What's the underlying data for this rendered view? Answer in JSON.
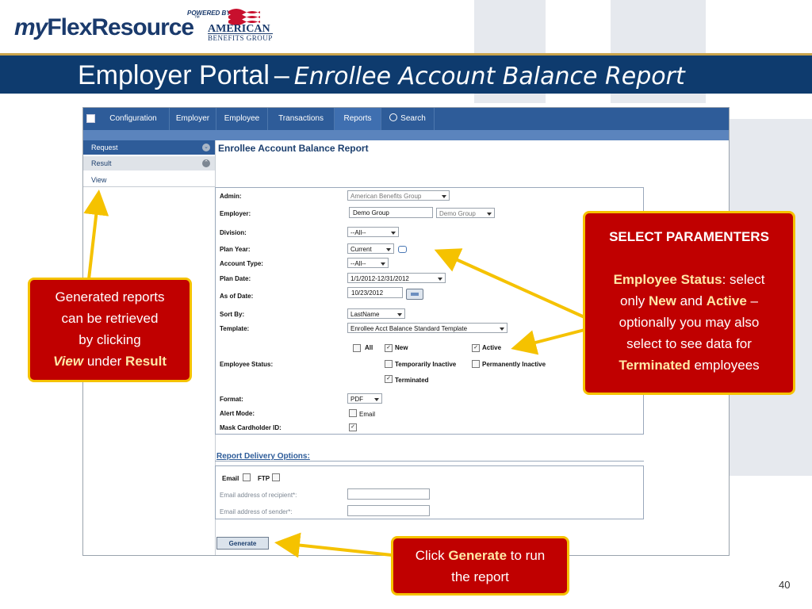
{
  "header": {
    "logo": {
      "my": "my",
      "flex": "FlexResource",
      "tm": "™"
    },
    "powered_by": "POWERED BY",
    "american_benefits": {
      "line1": "AMERICAN",
      "line2": "BENEFITS GROUP"
    }
  },
  "title": {
    "main": "Employer Portal",
    "dash": "–",
    "sub": "Enrollee Account Balance Report"
  },
  "app": {
    "nav_tabs": [
      "Configuration",
      "Employer",
      "Employee",
      "Transactions",
      "Reports",
      "Search"
    ],
    "active_tab": "Reports",
    "sidebar": {
      "request": "Request",
      "result": "Result",
      "view": "View"
    },
    "page_title": "Enrollee Account Balance Report",
    "form": {
      "admin_label": "Admin:",
      "admin_value": "American Benefits Group",
      "employer_label": "Employer:",
      "employer_input": "Demo Group",
      "employer_select": "Demo Group",
      "division_label": "Division:",
      "division_value": "--All--",
      "plan_year_label": "Plan Year:",
      "plan_year_value": "Current",
      "account_type_label": "Account Type:",
      "account_type_value": "--All--",
      "plan_date_label": "Plan Date:",
      "plan_date_value": "1/1/2012-12/31/2012",
      "as_of_date_label": "As of Date:",
      "as_of_date_value": "10/23/2012",
      "sort_by_label": "Sort By:",
      "sort_by_value": "LastName",
      "template_label": "Template:",
      "template_value": "Enrollee Acct Balance Standard Template",
      "employee_status_label": "Employee Status:",
      "status_all": "All",
      "status_new": "New",
      "status_active": "Active",
      "status_temp_inactive": "Temporarily Inactive",
      "status_perm_inactive": "Permanently Inactive",
      "status_terminated": "Terminated",
      "format_label": "Format:",
      "format_value": "PDF",
      "alert_mode_label": "Alert Mode:",
      "alert_email": "Email",
      "mask_label": "Mask Cardholder ID:"
    },
    "delivery": {
      "title": "Report Delivery Options:",
      "email_label": "Email",
      "ftp_label": "FTP",
      "recipient_label": "Email address of recipient*:",
      "sender_label": "Email address of sender*:"
    },
    "generate_button": "Generate"
  },
  "callouts": {
    "left": {
      "line1": "Generated reports",
      "line2": "can be retrieved",
      "line3": "by clicking",
      "view": "View",
      "under": "under",
      "result": "Result"
    },
    "right": {
      "heading": "SELECT PARAMENTERS",
      "emp_status": "Employee Status",
      "t1": ":  select",
      "t2": "only",
      "new": "New",
      "and": "and",
      "active": "Active",
      "t3": "–",
      "t4": "optionally you may also",
      "t5": "select to see data for",
      "terminated": "Terminated",
      "t6": "employees"
    },
    "bottom": {
      "click": "Click",
      "generate": "Generate",
      "to_run": "to run",
      "the_report": "the report"
    }
  },
  "page_number": "40",
  "colors": {
    "title_bar": "#0e3b6e",
    "nav": "#2e5c99",
    "callout_bg": "#c00000",
    "callout_border": "#f5c200",
    "arrow": "#f5c200"
  }
}
